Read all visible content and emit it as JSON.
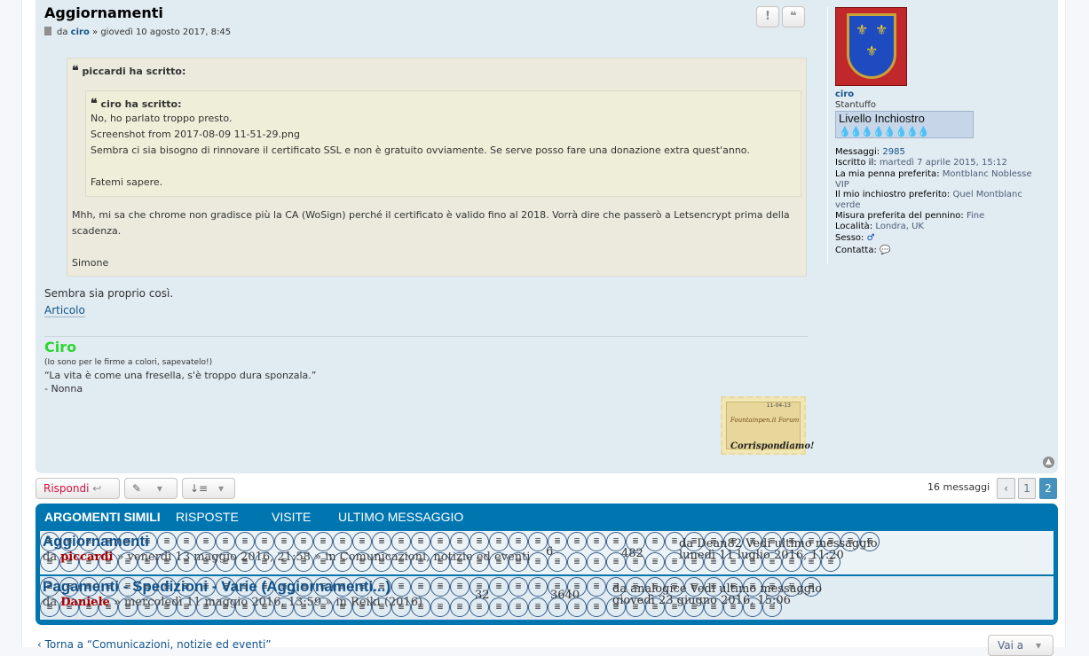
{
  "post": {
    "title": "Aggiornamenti",
    "meta_prefix": "da",
    "author": "ciro",
    "date": "» giovedì 10 agosto 2017, 8:45",
    "report_label": "!",
    "quote_btn_label": "❝",
    "outer_quote": {
      "cite": "piccardi ha scritto:",
      "inner_quote": {
        "cite": "ciro ha scritto:",
        "lines": [
          "No, ho parlato troppo presto.",
          "Screenshot from 2017-08-09 11-51-29.png",
          "Sembra ci sia bisogno di rinnovare il certificato SSL e non è gratuito ovviamente. Se serve posso fare una donazione extra quest'anno.",
          "",
          "Fatemi sapere."
        ]
      },
      "reply_line1": "Mhh, mi sa che chrome non gradisce più la CA (WoSign) perché il certificato è valido fino al 2018. Vorrà dire che passerò a Letsencrypt prima della",
      "reply_line2": "scadenza.",
      "reply_sign": "Simone"
    },
    "body_text": "Sembra sia proprio così.",
    "body_link": "Articolo",
    "signature": {
      "name": "Ciro",
      "note": "(Io sono per le firme a colori, sapevatelo!)",
      "quote": "“La vita è come una fresella, s'è troppo dura sponzala.”",
      "attribution": "- Nonna"
    },
    "stamp": {
      "date": "11-04-13",
      "title": "Fountainpen.it Forum",
      "motto": "Corrispondiamo!"
    }
  },
  "profile": {
    "username": "ciro",
    "rank": "Stantuffo",
    "rank_image_text": "Livello Inchiostro",
    "fields": [
      {
        "label": "Messaggi:",
        "value": "2985"
      },
      {
        "label": "Iscritto il:",
        "value": "martedì 7 aprile 2015, 15:12"
      },
      {
        "label": "La mia penna preferita:",
        "value": "Montblanc Noblesse VIP"
      },
      {
        "label": "Il mio inchiostro preferito:",
        "value": "Quel Montblanc verde"
      },
      {
        "label": "Misura preferita del pennino:",
        "value": "Fine"
      },
      {
        "label": "Località:",
        "value": "Londra, UK"
      },
      {
        "label": "Sesso:",
        "value": "♂"
      },
      {
        "label": "Contatta:",
        "value": "💬"
      }
    ]
  },
  "actions": {
    "reply_label": "Rispondi",
    "reply_icon": "↩",
    "tools_icon": "🔧",
    "sort_icon": "↓≡",
    "dropdown_icon": "▾",
    "message_count": "16 messaggi",
    "prev_icon": "‹",
    "pages": [
      "1",
      "2"
    ],
    "current_page": "2"
  },
  "similar": {
    "headers": [
      "ARGOMENTI SIMILI",
      "RISPOSTE",
      "VISITE",
      "ULTIMO MESSAGGIO"
    ],
    "rows": [
      {
        "title": "Aggiornamenti",
        "by": "da",
        "author": "piccardi",
        "meta": "» venerdì 13 maggio 2016, 21:58 » in Comunicazioni, notizie ed eventi",
        "replies": "6",
        "views": "482",
        "last1": "da Dean82 Vedi ultimo messaggio",
        "last2": "lunedì 11 luglio 2016, 11:20"
      },
      {
        "title": "Pagamenti - Spedizioni - Varie (Aggiornamenti...)",
        "by": "da",
        "author": "Daniele",
        "meta": "» mercoledì 11 maggio 2016, 13:59 » in Reiki (2016)",
        "replies": "32",
        "views": "3640",
        "last1": "da analogice Vedi ultimo messaggio",
        "last2": "giovedì 23 giugno 2016, 15:06"
      }
    ]
  },
  "footer": {
    "back_link": "‹ Torna a “Comunicazioni, notizie ed eventi”",
    "goto_label": "Vai a"
  },
  "colors": {
    "post_bg": "#e1ebf2",
    "link": "#105289",
    "accent_red": "#d31141",
    "header_blue": "#0076b1",
    "signature_green": "#2dd531"
  }
}
